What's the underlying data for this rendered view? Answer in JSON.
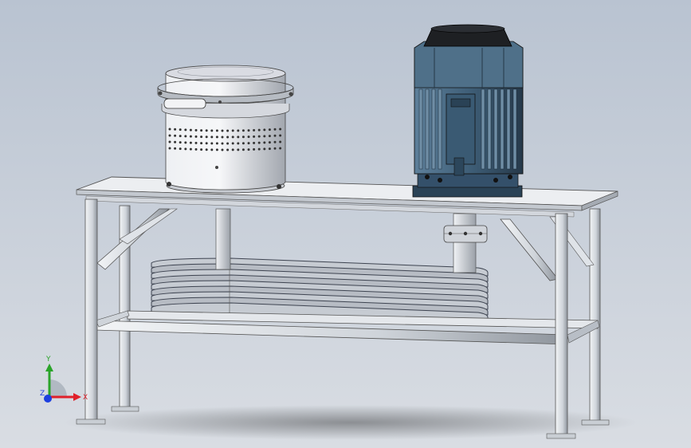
{
  "viewport": {
    "background": {
      "top": "#b9c3d1",
      "bottom": "#d9dde3"
    }
  },
  "triad": {
    "x_label": "X",
    "y_label": "Y",
    "z_label": "Z",
    "colors": {
      "x": "#e0202a",
      "y": "#2aa42a",
      "z": "#1c3fe0"
    }
  },
  "model": {
    "colors": {
      "steel": "#d6dbe1",
      "steel_dark": "#a9b0b8",
      "motor": "#3f5f78",
      "motor_dark": "#2a4256",
      "motor_cap": "#1e2023",
      "housing": "#cfd2d8",
      "disc": "#b7bcc4",
      "disc_line": "#3d4350"
    }
  }
}
